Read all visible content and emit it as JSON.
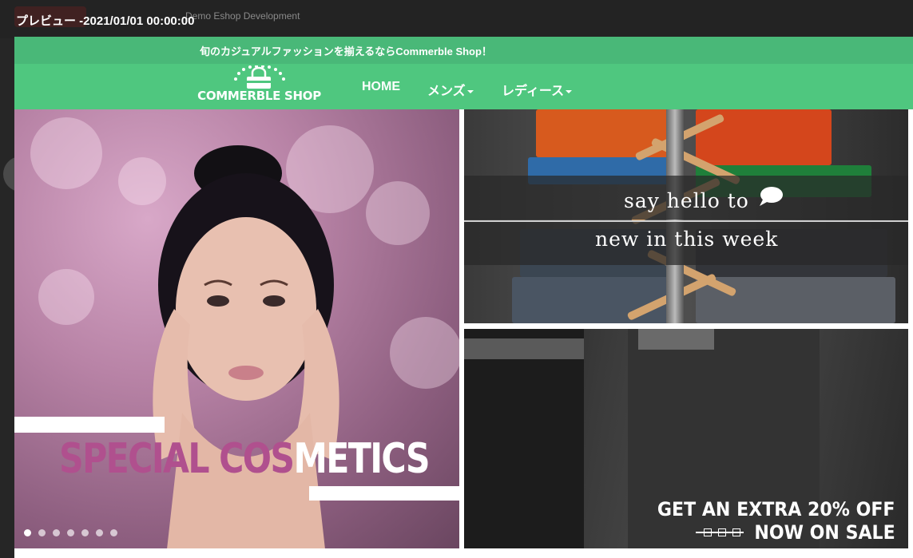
{
  "admin_bar": {
    "site_title": "Demo Eshop Development"
  },
  "preview": {
    "title": "プレビュー -2021/01/01 00:00:00"
  },
  "topbar": {
    "text": "旬のカジュアルファッションを揃えるならCommerble Shop！"
  },
  "navbar": {
    "logo_text": "COMMERBLE SHOP",
    "items": [
      {
        "label": "HOME",
        "has_dropdown": false
      },
      {
        "label": "メンズ",
        "has_dropdown": true
      },
      {
        "label": "レディース",
        "has_dropdown": true
      }
    ]
  },
  "hero_left": {
    "title_pink": "SPECIAL COS",
    "title_white": "METICS",
    "slide_count": 7,
    "active_slide": 0
  },
  "hero_top_right": {
    "line1": "say hello to",
    "line2": "new in this week"
  },
  "hero_bottom_right": {
    "line1": "GET AN EXTRA 20% OFF",
    "line2": "NOW ON SALE"
  },
  "colors": {
    "nav_green": "#4fc77f",
    "topbar_green": "#49b878",
    "cosmetics_pink": "#b0508e"
  }
}
